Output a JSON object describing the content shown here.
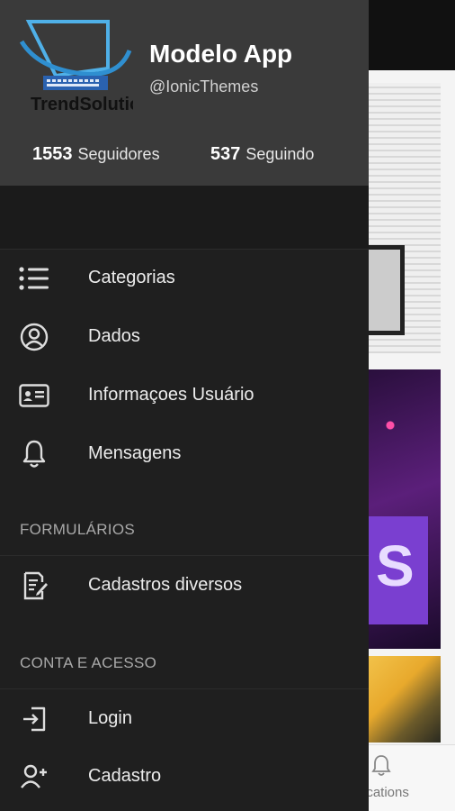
{
  "background": {
    "tab_label": "ications"
  },
  "header": {
    "logo_text": "TrendSolutio",
    "app_name": "Modelo App",
    "handle": "@IonicThemes",
    "followers_count": "1553",
    "followers_label": "Seguidores",
    "following_count": "537",
    "following_label": "Seguindo"
  },
  "menu": {
    "items": [
      {
        "label": "Categorias",
        "icon": "list-icon"
      },
      {
        "label": "Dados",
        "icon": "user-circle-icon"
      },
      {
        "label": "Informaçoes Usuário",
        "icon": "id-card-icon"
      },
      {
        "label": "Mensagens",
        "icon": "bell-icon"
      }
    ]
  },
  "sections": [
    {
      "title": "FORMULÁRIOS",
      "items": [
        {
          "label": "Cadastros diversos",
          "icon": "edit-document-icon"
        }
      ]
    },
    {
      "title": "CONTA E ACESSO",
      "items": [
        {
          "label": "Login",
          "icon": "login-icon"
        },
        {
          "label": "Cadastro",
          "icon": "add-user-icon"
        }
      ]
    }
  ],
  "colors": {
    "drawer_bg": "#1f1f1f",
    "header_bg": "#3a3a3a",
    "text": "#ececec",
    "section_title": "#a9a9a9"
  }
}
